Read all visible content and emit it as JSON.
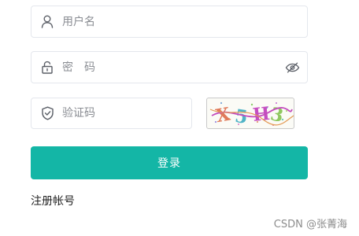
{
  "form": {
    "username": {
      "placeholder": "用户名",
      "value": "",
      "icon": "user-icon"
    },
    "password": {
      "placeholder": "密码",
      "value": "",
      "icon": "lock-icon",
      "toggle_icon": "eye-hidden-icon"
    },
    "captcha": {
      "placeholder": "验证码",
      "value": "",
      "icon": "shield-check-icon",
      "image_text": "X5H3"
    },
    "login_label": "登录",
    "register_label": "注册帐号"
  },
  "watermark": "CSDN @张菁海",
  "colors": {
    "primary": "#14b6a6",
    "border": "#e4e7ed",
    "placeholder": "#8a8d93"
  }
}
